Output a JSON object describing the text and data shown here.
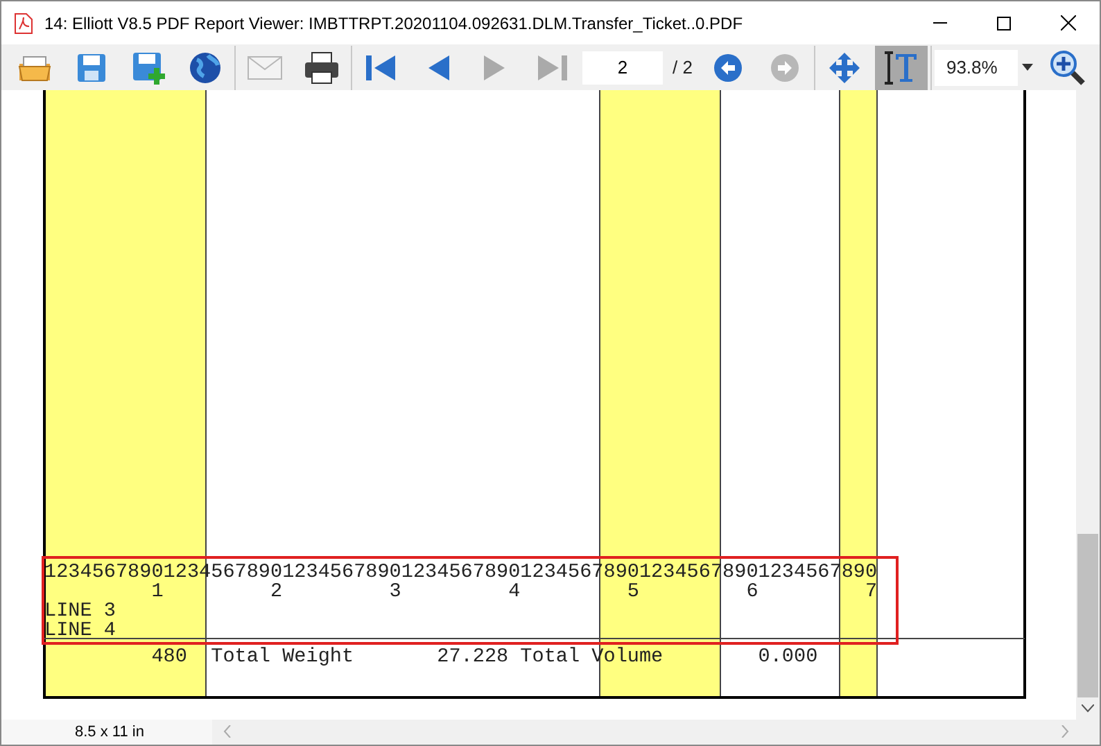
{
  "window": {
    "title": "14: Elliott V8.5 PDF Report Viewer: IMBTTRPT.20201104.092631.DLM.Transfer_Ticket..0.PDF"
  },
  "toolbar": {
    "groups": [
      [
        {
          "kind": "open",
          "disabled": false
        },
        {
          "kind": "save",
          "disabled": false
        },
        {
          "kind": "save-add",
          "disabled": false
        },
        {
          "kind": "globe",
          "disabled": false
        }
      ],
      [
        {
          "kind": "mail",
          "disabled": true
        },
        {
          "kind": "print",
          "disabled": false
        }
      ],
      [
        {
          "kind": "first",
          "disabled": false
        },
        {
          "kind": "prev",
          "disabled": false
        },
        {
          "kind": "next",
          "disabled": true
        },
        {
          "kind": "last",
          "disabled": true
        },
        {
          "kind": "page-field",
          "value": "2"
        },
        {
          "kind": "page-count",
          "text": "/ 2"
        },
        {
          "kind": "back",
          "disabled": false
        },
        {
          "kind": "forward",
          "disabled": true
        }
      ],
      [
        {
          "kind": "pan",
          "selected": false
        },
        {
          "kind": "text-select",
          "selected": true
        }
      ],
      [
        {
          "kind": "zoom-field",
          "value": "93.8%"
        },
        {
          "kind": "zoom-in",
          "disabled": false
        }
      ]
    ]
  },
  "report": {
    "selection": {
      "lines": [
        "1234567890123456789012345678901234567890123456789012345678901234567890",
        "         1         2         3         4         5         6         7",
        "LINE 3",
        "LINE 4"
      ]
    },
    "lines": [
      "         480  Total Weight       27.228 Total Volume        0.000"
    ]
  },
  "status_bar": {
    "page_size": "8.5 x 11 in"
  }
}
